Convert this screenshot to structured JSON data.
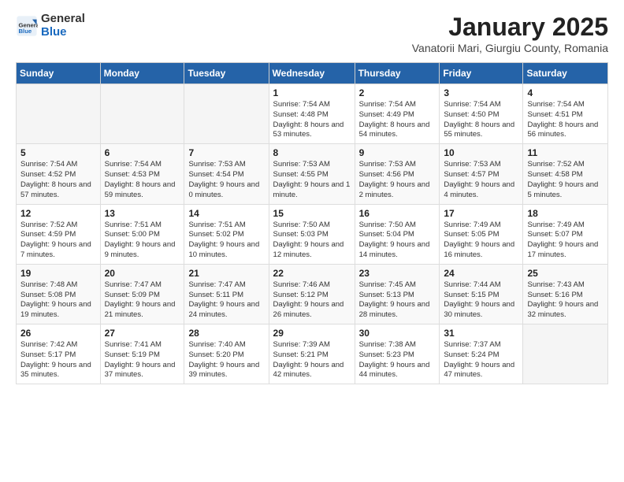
{
  "logo": {
    "general": "General",
    "blue": "Blue"
  },
  "title": "January 2025",
  "subtitle": "Vanatorii Mari, Giurgiu County, Romania",
  "weekdays": [
    "Sunday",
    "Monday",
    "Tuesday",
    "Wednesday",
    "Thursday",
    "Friday",
    "Saturday"
  ],
  "weeks": [
    [
      {
        "day": "",
        "empty": true
      },
      {
        "day": "",
        "empty": true
      },
      {
        "day": "",
        "empty": true
      },
      {
        "day": "1",
        "sunrise": "7:54 AM",
        "sunset": "4:48 PM",
        "daylight": "8 hours and 53 minutes."
      },
      {
        "day": "2",
        "sunrise": "7:54 AM",
        "sunset": "4:49 PM",
        "daylight": "8 hours and 54 minutes."
      },
      {
        "day": "3",
        "sunrise": "7:54 AM",
        "sunset": "4:50 PM",
        "daylight": "8 hours and 55 minutes."
      },
      {
        "day": "4",
        "sunrise": "7:54 AM",
        "sunset": "4:51 PM",
        "daylight": "8 hours and 56 minutes."
      }
    ],
    [
      {
        "day": "5",
        "sunrise": "7:54 AM",
        "sunset": "4:52 PM",
        "daylight": "8 hours and 57 minutes."
      },
      {
        "day": "6",
        "sunrise": "7:54 AM",
        "sunset": "4:53 PM",
        "daylight": "8 hours and 59 minutes."
      },
      {
        "day": "7",
        "sunrise": "7:53 AM",
        "sunset": "4:54 PM",
        "daylight": "9 hours and 0 minutes."
      },
      {
        "day": "8",
        "sunrise": "7:53 AM",
        "sunset": "4:55 PM",
        "daylight": "9 hours and 1 minute."
      },
      {
        "day": "9",
        "sunrise": "7:53 AM",
        "sunset": "4:56 PM",
        "daylight": "9 hours and 2 minutes."
      },
      {
        "day": "10",
        "sunrise": "7:53 AM",
        "sunset": "4:57 PM",
        "daylight": "9 hours and 4 minutes."
      },
      {
        "day": "11",
        "sunrise": "7:52 AM",
        "sunset": "4:58 PM",
        "daylight": "9 hours and 5 minutes."
      }
    ],
    [
      {
        "day": "12",
        "sunrise": "7:52 AM",
        "sunset": "4:59 PM",
        "daylight": "9 hours and 7 minutes."
      },
      {
        "day": "13",
        "sunrise": "7:51 AM",
        "sunset": "5:00 PM",
        "daylight": "9 hours and 9 minutes."
      },
      {
        "day": "14",
        "sunrise": "7:51 AM",
        "sunset": "5:02 PM",
        "daylight": "9 hours and 10 minutes."
      },
      {
        "day": "15",
        "sunrise": "7:50 AM",
        "sunset": "5:03 PM",
        "daylight": "9 hours and 12 minutes."
      },
      {
        "day": "16",
        "sunrise": "7:50 AM",
        "sunset": "5:04 PM",
        "daylight": "9 hours and 14 minutes."
      },
      {
        "day": "17",
        "sunrise": "7:49 AM",
        "sunset": "5:05 PM",
        "daylight": "9 hours and 16 minutes."
      },
      {
        "day": "18",
        "sunrise": "7:49 AM",
        "sunset": "5:07 PM",
        "daylight": "9 hours and 17 minutes."
      }
    ],
    [
      {
        "day": "19",
        "sunrise": "7:48 AM",
        "sunset": "5:08 PM",
        "daylight": "9 hours and 19 minutes."
      },
      {
        "day": "20",
        "sunrise": "7:47 AM",
        "sunset": "5:09 PM",
        "daylight": "9 hours and 21 minutes."
      },
      {
        "day": "21",
        "sunrise": "7:47 AM",
        "sunset": "5:11 PM",
        "daylight": "9 hours and 24 minutes."
      },
      {
        "day": "22",
        "sunrise": "7:46 AM",
        "sunset": "5:12 PM",
        "daylight": "9 hours and 26 minutes."
      },
      {
        "day": "23",
        "sunrise": "7:45 AM",
        "sunset": "5:13 PM",
        "daylight": "9 hours and 28 minutes."
      },
      {
        "day": "24",
        "sunrise": "7:44 AM",
        "sunset": "5:15 PM",
        "daylight": "9 hours and 30 minutes."
      },
      {
        "day": "25",
        "sunrise": "7:43 AM",
        "sunset": "5:16 PM",
        "daylight": "9 hours and 32 minutes."
      }
    ],
    [
      {
        "day": "26",
        "sunrise": "7:42 AM",
        "sunset": "5:17 PM",
        "daylight": "9 hours and 35 minutes."
      },
      {
        "day": "27",
        "sunrise": "7:41 AM",
        "sunset": "5:19 PM",
        "daylight": "9 hours and 37 minutes."
      },
      {
        "day": "28",
        "sunrise": "7:40 AM",
        "sunset": "5:20 PM",
        "daylight": "9 hours and 39 minutes."
      },
      {
        "day": "29",
        "sunrise": "7:39 AM",
        "sunset": "5:21 PM",
        "daylight": "9 hours and 42 minutes."
      },
      {
        "day": "30",
        "sunrise": "7:38 AM",
        "sunset": "5:23 PM",
        "daylight": "9 hours and 44 minutes."
      },
      {
        "day": "31",
        "sunrise": "7:37 AM",
        "sunset": "5:24 PM",
        "daylight": "9 hours and 47 minutes."
      },
      {
        "day": "",
        "empty": true
      }
    ]
  ]
}
